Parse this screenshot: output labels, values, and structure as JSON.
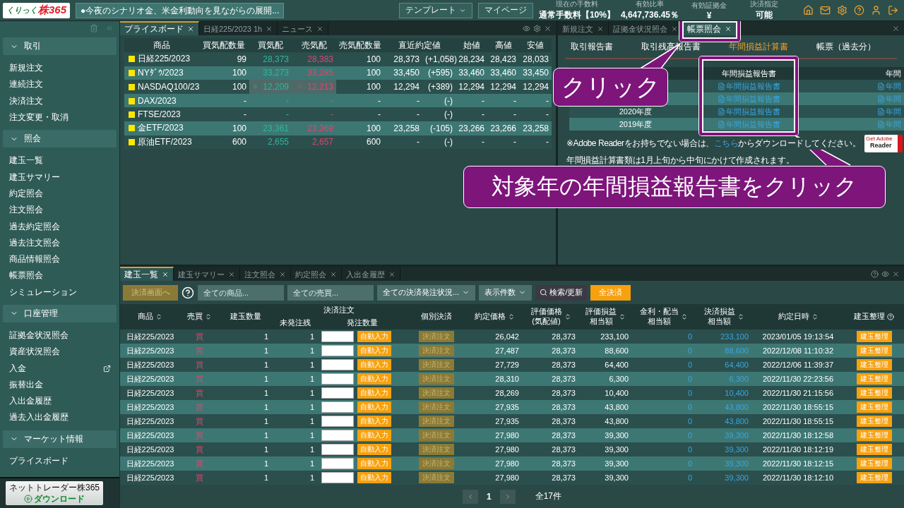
{
  "top_bar": {
    "logo": {
      "small": "くりっく",
      "big": "株365"
    },
    "news": "●今夜のシナリオ金、米金利動向を見ながらの展開...",
    "buttons": [
      {
        "label": "テンプレート",
        "dropdown": true
      },
      {
        "label": "マイページ",
        "dropdown": false
      }
    ],
    "stats": [
      {
        "label": "現在の手数料",
        "value": "通常手数料【10%】"
      },
      {
        "label": "有効比率",
        "value": "4,647,736.45％"
      },
      {
        "label": "有効証拠金",
        "value": "¥"
      },
      {
        "label": "決済指定",
        "value": "可能"
      }
    ]
  },
  "sidebar": {
    "sections": [
      {
        "title": "取引",
        "expanded": true,
        "items": [
          {
            "label": "新規注文",
            "external": false
          },
          {
            "label": "連続注文",
            "external": false
          },
          {
            "label": "決済注文",
            "external": false
          },
          {
            "label": "注文変更・取消",
            "external": false
          }
        ]
      },
      {
        "title": "照会",
        "expanded": true,
        "items": [
          {
            "label": "建玉一覧",
            "external": false
          },
          {
            "label": "建玉サマリー",
            "external": false
          },
          {
            "label": "約定照会",
            "external": false
          },
          {
            "label": "注文照会",
            "external": false
          },
          {
            "label": "過去約定照会",
            "external": false
          },
          {
            "label": "過去注文照会",
            "external": false
          },
          {
            "label": "商品情報照会",
            "external": false
          },
          {
            "label": "帳票照会",
            "external": false
          },
          {
            "label": "シミュレーション",
            "external": false
          }
        ]
      },
      {
        "title": "口座管理",
        "expanded": true,
        "items": [
          {
            "label": "証拠金状況照会",
            "external": false
          },
          {
            "label": "資産状況照会",
            "external": false
          },
          {
            "label": "入金",
            "external": true
          },
          {
            "label": "振替出金",
            "external": false
          },
          {
            "label": "入出金履歴",
            "external": false
          },
          {
            "label": "過去入出金履歴",
            "external": false
          }
        ]
      },
      {
        "title": "マーケット情報",
        "expanded": true,
        "items": [
          {
            "label": "プライスボード",
            "external": false
          }
        ]
      }
    ],
    "download": {
      "title": "ネットトレーダー株365",
      "button": "ダウンロード"
    }
  },
  "price_board": {
    "tabs": [
      {
        "label": "プライスボード",
        "selected": true
      },
      {
        "label": "日経225/2023 1h",
        "selected": false
      },
      {
        "label": "ニュース",
        "selected": false
      }
    ],
    "columns": [
      "商品",
      "買気配数量",
      "買気配",
      "売気配",
      "売気配数量",
      "直近約定値",
      "始値",
      "高値",
      "安値"
    ],
    "rows": [
      {
        "name": "日経225/2023",
        "bid_qty": "99",
        "bid": "28,373",
        "ask": "28,383",
        "ask_qty": "100",
        "last": "28,373",
        "change": "(+1,058)",
        "open": "28,234",
        "high": "28,423",
        "low": "28,033",
        "falling": false
      },
      {
        "name": "NYﾀﾞｳ/2023",
        "bid_qty": "100",
        "bid": "33,273",
        "ask": "33,285",
        "ask_qty": "100",
        "last": "33,450",
        "change": "(+595)",
        "open": "33,460",
        "high": "33,460",
        "low": "33,450",
        "falling": false
      },
      {
        "name": "NASDAQ100/23",
        "bid_qty": "100",
        "bid": "12,209",
        "ask": "12,213",
        "ask_qty": "100",
        "last": "12,294",
        "change": "(+389)",
        "open": "12,294",
        "high": "12,294",
        "low": "12,294",
        "falling": true
      },
      {
        "name": "DAX/2023",
        "bid_qty": "-",
        "bid": "-",
        "ask": "-",
        "ask_qty": "-",
        "last": "-",
        "change": "(-)",
        "open": "-",
        "high": "-",
        "low": "-",
        "falling": false
      },
      {
        "name": "FTSE/2023",
        "bid_qty": "-",
        "bid": "-",
        "ask": "-",
        "ask_qty": "-",
        "last": "-",
        "change": "(-)",
        "open": "-",
        "high": "-",
        "low": "-",
        "falling": false
      },
      {
        "name": "金ETF/2023",
        "bid_qty": "100",
        "bid": "23,361",
        "ask": "23,369",
        "ask_qty": "100",
        "last": "23,258",
        "change": "(-105)",
        "open": "23,266",
        "high": "23,266",
        "low": "23,258",
        "falling": false
      },
      {
        "name": "原油ETF/2023",
        "bid_qty": "600",
        "bid": "2,655",
        "ask": "2,657",
        "ask_qty": "600",
        "last": "-",
        "change": "(-)",
        "open": "-",
        "high": "-",
        "low": "-",
        "falling": false
      }
    ]
  },
  "report_panel": {
    "tabs": [
      {
        "label": "新規注文",
        "selected": false
      },
      {
        "label": "証拠金状況照会",
        "selected": false
      },
      {
        "label": "帳票照会",
        "selected": true
      }
    ],
    "subtabs": [
      {
        "label": "取引報告書",
        "selected": false
      },
      {
        "label": "取引残高報告書",
        "selected": false
      },
      {
        "label": "年間損益計算書",
        "selected": true
      },
      {
        "label": "帳票（過去分）",
        "selected": false
      }
    ],
    "columns": [
      "年間損益報告書",
      "年間"
    ],
    "rows": [
      {
        "report": "年間損益報告書",
        "column_3": "年間"
      },
      {
        "report": "年間損益報告書",
        "column_3": "年間"
      },
      {
        "year": "2020年度",
        "report": "年間損益報告書",
        "column_3": "年間"
      },
      {
        "year": "2019年度",
        "report": "年間損益報告書",
        "column_3": "年間"
      }
    ],
    "notice": {
      "before": "※Adobe Readerをお持ちでない場合は、",
      "link": "こちら",
      "after": "からダウンロードしてください。"
    },
    "adobe_badge": {
      "top": "Get Adobe",
      "bottom": "Reader"
    },
    "note": "年間損益計算書類は1月上旬から中旬にかけて作成されます。"
  },
  "positions": {
    "tabs": [
      {
        "label": "建玉一覧",
        "selected": true
      },
      {
        "label": "建玉サマリー",
        "selected": false
      },
      {
        "label": "注文照会",
        "selected": false
      },
      {
        "label": "約定照会",
        "selected": false
      },
      {
        "label": "入出金履歴",
        "selected": false
      }
    ],
    "toolbar": {
      "settle_screen": "決済画面へ",
      "filters": [
        {
          "kind": "input",
          "placeholder": "全ての商品..."
        },
        {
          "kind": "input",
          "placeholder": "全ての売買..."
        },
        {
          "kind": "select",
          "value": "全ての決済発注状況..."
        },
        {
          "kind": "select",
          "value": "表示件数"
        }
      ],
      "search": "検索/更新",
      "settle_all": "全決済"
    },
    "columns": [
      {
        "label": [
          "商品"
        ],
        "sortable": true
      },
      {
        "label": [
          "売買"
        ],
        "sortable": true
      },
      {
        "label": [
          "建玉数量"
        ],
        "sortable": false
      },
      {
        "label": [
          "決済注文"
        ],
        "sortable": false,
        "children": [
          {
            "label": "未発注残"
          },
          {
            "label": "発注数量"
          }
        ]
      },
      {
        "label": [
          "個別決済"
        ],
        "sortable": false
      },
      {
        "label": [
          "約定価格"
        ],
        "sortable": true
      },
      {
        "label": [
          "評価価格",
          "(気配値)"
        ],
        "sortable": true
      },
      {
        "label": [
          "評価損益",
          "相当額"
        ],
        "sortable": true
      },
      {
        "label": [
          "金利・配当",
          "相当額"
        ],
        "sortable": true
      },
      {
        "label": [
          "決済損益",
          "相当額"
        ],
        "sortable": true
      },
      {
        "label": [
          "約定日時"
        ],
        "sortable": true
      },
      {
        "label": [
          "建玉整理"
        ],
        "sortable": false,
        "help": true
      }
    ],
    "rows": [
      {
        "product": "日経225/2023",
        "side": "買",
        "quantity": "1",
        "unordered": "1",
        "auto_button": "自動入力",
        "settle_button": "決済注文",
        "price": "26,042",
        "eval_price": "28,373",
        "eval_pl": "233,100",
        "interest": "0",
        "settle_pl": "233,100",
        "datetime": "2023/01/05 19:13:54",
        "manage_button": "建玉整理"
      },
      {
        "product": "日経225/2023",
        "side": "買",
        "quantity": "1",
        "unordered": "1",
        "auto_button": "自動入力",
        "settle_button": "決済注文",
        "price": "27,487",
        "eval_price": "28,373",
        "eval_pl": "88,600",
        "interest": "0",
        "settle_pl": "88,600",
        "datetime": "2022/12/08 11:10:32",
        "manage_button": "建玉整理"
      },
      {
        "product": "日経225/2023",
        "side": "買",
        "quantity": "1",
        "unordered": "1",
        "auto_button": "自動入力",
        "settle_button": "決済注文",
        "price": "27,729",
        "eval_price": "28,373",
        "eval_pl": "64,400",
        "interest": "0",
        "settle_pl": "64,400",
        "datetime": "2022/12/06 11:39:37",
        "manage_button": "建玉整理"
      },
      {
        "product": "日経225/2023",
        "side": "買",
        "quantity": "1",
        "unordered": "1",
        "auto_button": "自動入力",
        "settle_button": "決済注文",
        "price": "28,310",
        "eval_price": "28,373",
        "eval_pl": "6,300",
        "interest": "0",
        "settle_pl": "6,300",
        "datetime": "2022/11/30 22:23:56",
        "manage_button": "建玉整理"
      },
      {
        "product": "日経225/2023",
        "side": "買",
        "quantity": "1",
        "unordered": "1",
        "auto_button": "自動入力",
        "settle_button": "決済注文",
        "price": "28,269",
        "eval_price": "28,373",
        "eval_pl": "10,400",
        "interest": "0",
        "settle_pl": "10,400",
        "datetime": "2022/11/30 21:15:56",
        "manage_button": "建玉整理"
      },
      {
        "product": "日経225/2023",
        "side": "買",
        "quantity": "1",
        "unordered": "1",
        "auto_button": "自動入力",
        "settle_button": "決済注文",
        "price": "27,935",
        "eval_price": "28,373",
        "eval_pl": "43,800",
        "interest": "0",
        "settle_pl": "43,800",
        "datetime": "2022/11/30 18:55:15",
        "manage_button": "建玉整理"
      },
      {
        "product": "日経225/2023",
        "side": "買",
        "quantity": "1",
        "unordered": "1",
        "auto_button": "自動入力",
        "settle_button": "決済注文",
        "price": "27,935",
        "eval_price": "28,373",
        "eval_pl": "43,800",
        "interest": "0",
        "settle_pl": "43,800",
        "datetime": "2022/11/30 18:55:15",
        "manage_button": "建玉整理"
      },
      {
        "product": "日経225/2023",
        "side": "買",
        "quantity": "1",
        "unordered": "1",
        "auto_button": "自動入力",
        "settle_button": "決済注文",
        "price": "27,980",
        "eval_price": "28,373",
        "eval_pl": "39,300",
        "interest": "0",
        "settle_pl": "39,300",
        "datetime": "2022/11/30 18:12:58",
        "manage_button": "建玉整理"
      },
      {
        "product": "日経225/2023",
        "side": "買",
        "quantity": "1",
        "unordered": "1",
        "auto_button": "自動入力",
        "settle_button": "決済注文",
        "price": "27,980",
        "eval_price": "28,373",
        "eval_pl": "39,300",
        "interest": "0",
        "settle_pl": "39,300",
        "datetime": "2022/11/30 18:12:19",
        "manage_button": "建玉整理"
      },
      {
        "product": "日経225/2023",
        "side": "買",
        "quantity": "1",
        "unordered": "1",
        "auto_button": "自動入力",
        "settle_button": "決済注文",
        "price": "27,980",
        "eval_price": "28,373",
        "eval_pl": "39,300",
        "interest": "0",
        "settle_pl": "39,300",
        "datetime": "2022/11/30 18:12:15",
        "manage_button": "建玉整理"
      },
      {
        "product": "日経225/2023",
        "side": "買",
        "quantity": "1",
        "unordered": "1",
        "auto_button": "自動入力",
        "settle_button": "決済注文",
        "price": "27,980",
        "eval_price": "28,373",
        "eval_pl": "39,300",
        "interest": "0",
        "settle_pl": "39,300",
        "datetime": "2022/11/30 18:12:10",
        "manage_button": "建玉整理"
      }
    ],
    "pagination": {
      "page": "1",
      "total": "全17件"
    }
  },
  "callouts": [
    {
      "text": "クリック"
    },
    {
      "text": "対象年の年間損益報告書をクリック"
    }
  ]
}
